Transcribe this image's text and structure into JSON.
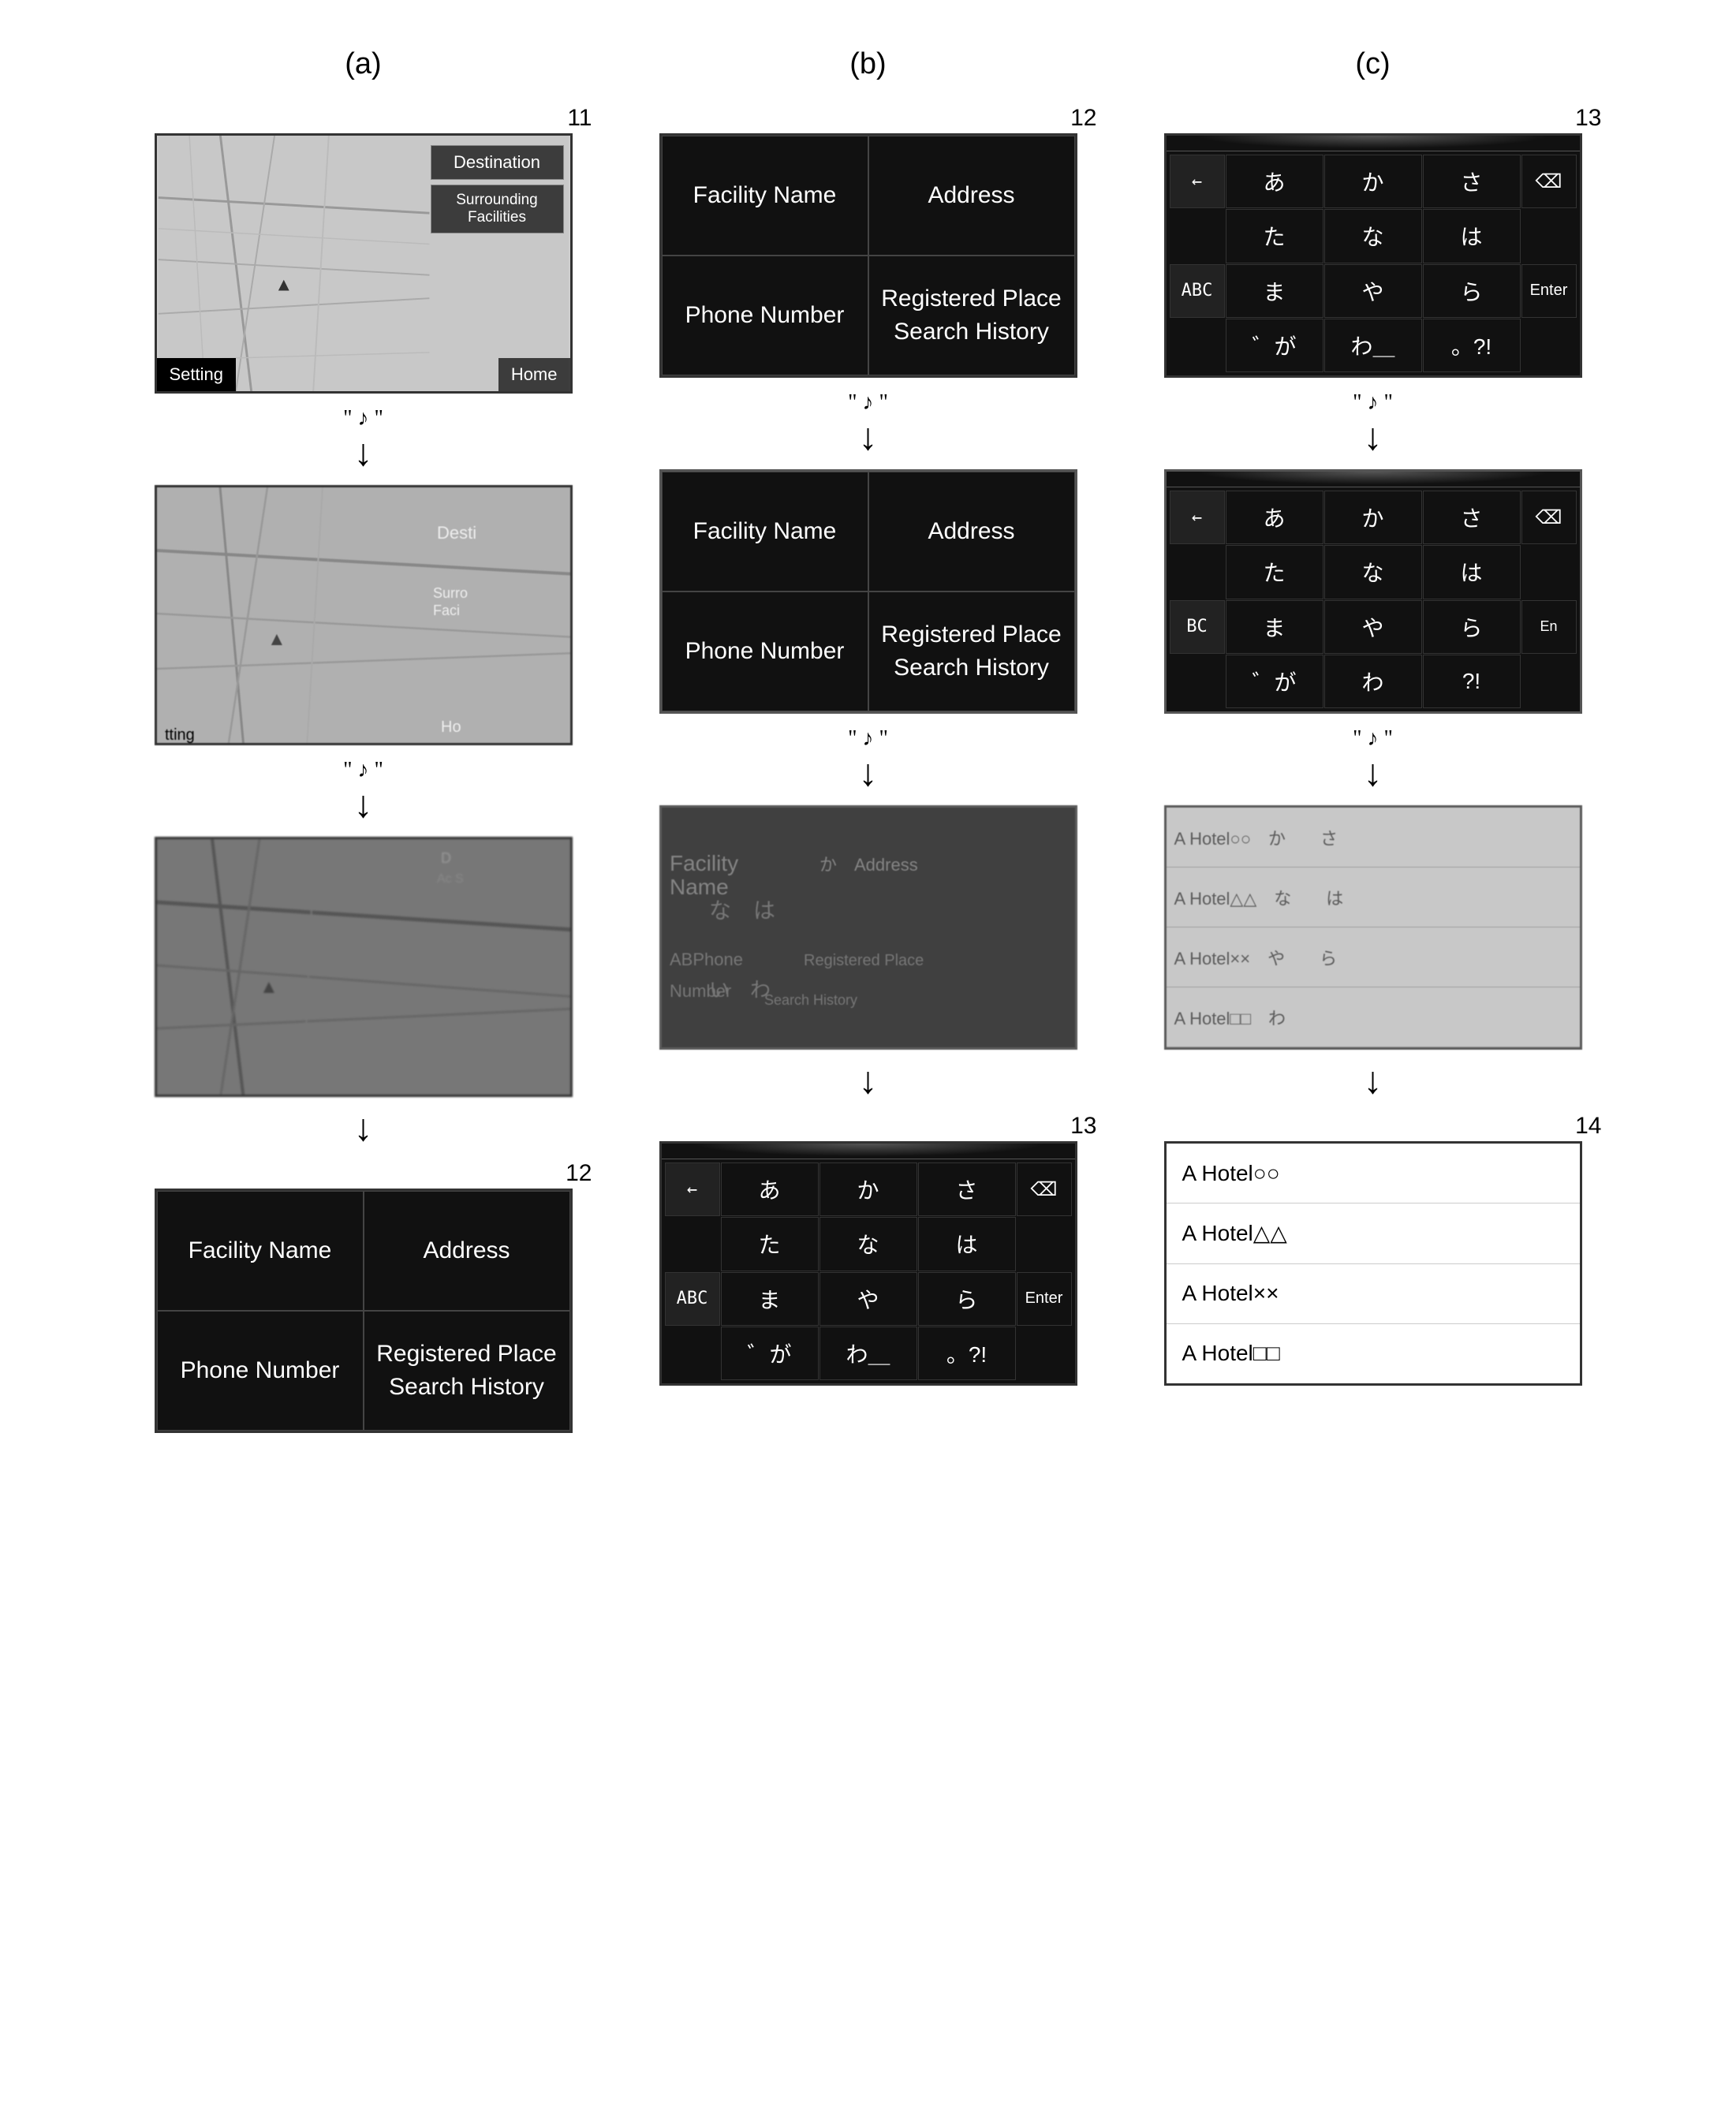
{
  "columns": {
    "a": {
      "label": "(a)"
    },
    "b": {
      "label": "(b)"
    },
    "c": {
      "label": "(c)"
    }
  },
  "numbers": {
    "n11": "11",
    "n12a": "12",
    "n12b": "12",
    "n13a": "13",
    "n13b": "13",
    "n14": "14"
  },
  "transition": {
    "note": "\" ♪ \"",
    "arrow": "↓"
  },
  "map": {
    "destination": "Destination",
    "surrounding": "Surrounding\nFacilities",
    "setting": "Setting",
    "home": "Home",
    "desti_short": "Desti",
    "surro_short": "Surro\nFaci",
    "ho_short": "Ho",
    "tting": "tting"
  },
  "menu": {
    "facility_name": "Facility\nName",
    "address": "Address",
    "phone_number": "Phone\nNumber",
    "registered": "Registered Place\nSearch History"
  },
  "kana": {
    "row1": [
      "あ",
      "か",
      "さ"
    ],
    "row2": [
      "た",
      "な",
      "は"
    ],
    "row3": [
      "ま",
      "や",
      "ら"
    ],
    "row4": [
      "゛が",
      "わ＿",
      "。?!"
    ],
    "abc_btn": "ABC",
    "enter_btn": "Enter",
    "back_arrow": "←",
    "backspace": "⌫"
  },
  "results": {
    "items": [
      "A Hotel○○",
      "A Hotel△△",
      "A Hotel××",
      "A Hotel□□"
    ]
  },
  "distort_results": {
    "items": [
      "A Hotel○○　か　　さ",
      "A Hotel△△　な　　は",
      "A Hotel××　や　　ら",
      "A Hotel□□　わ"
    ]
  }
}
